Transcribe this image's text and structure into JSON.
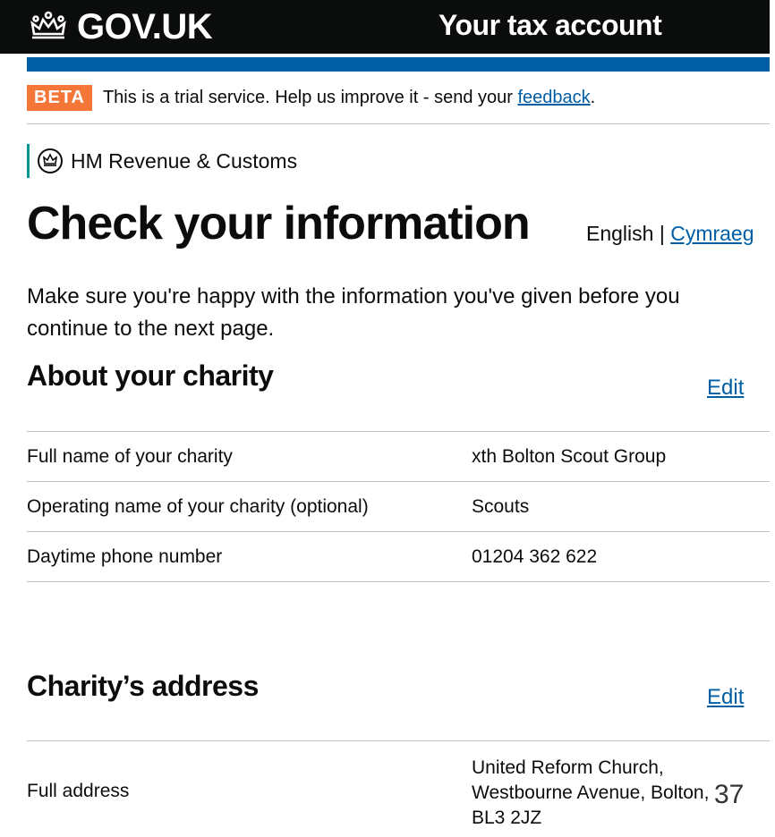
{
  "header": {
    "logo_text": "GOV.UK",
    "service_name": "Your tax account"
  },
  "beta": {
    "tag": "BETA",
    "text": "This is a trial service. Help us improve it - send your ",
    "link": "feedback",
    "suffix": "."
  },
  "org": {
    "name": "HM Revenue & Customs"
  },
  "page": {
    "title": "Check your information",
    "lang_current": "English",
    "lang_separator": " | ",
    "lang_other": "Cymraeg",
    "lead": "Make sure you're happy with the information you've given before you continue to the next page."
  },
  "about": {
    "heading": "About your charity",
    "edit": "Edit",
    "rows": [
      {
        "label": "Full name of your charity",
        "value": "xth Bolton Scout Group"
      },
      {
        "label": "Operating name of your charity (optional)",
        "value": "Scouts"
      },
      {
        "label": "Daytime phone number",
        "value": "01204 362 622"
      }
    ]
  },
  "address": {
    "heading": "Charity’s address",
    "edit": "Edit",
    "label": "Full address",
    "lines": [
      "United Reform Church,",
      "Westbourne Avenue, Bolton,",
      "BL3 2JZ"
    ]
  },
  "slide_number": "37",
  "colors": {
    "header_bg": "#0b0c0c",
    "blue_band": "#005ea5",
    "beta_tag": "#f47738",
    "link": "#005ea5",
    "org_border": "#009390"
  }
}
